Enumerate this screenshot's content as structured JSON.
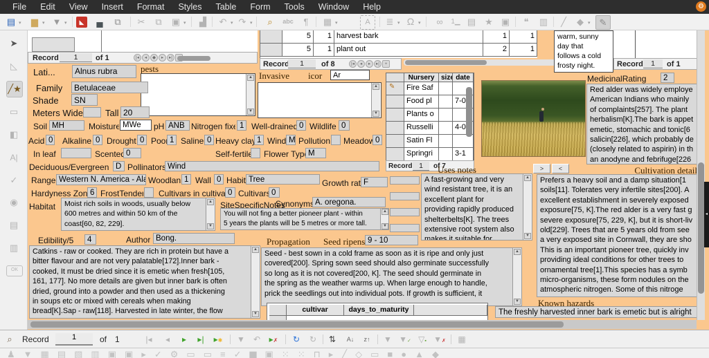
{
  "menubar": {
    "items": [
      "File",
      "Edit",
      "View",
      "Insert",
      "Format",
      "Styles",
      "Table",
      "Form",
      "Tools",
      "Window",
      "Help"
    ]
  },
  "navs": {
    "tl": {
      "label": "Record",
      "value": "1",
      "of": "of 1"
    },
    "task": {
      "label": "Record",
      "value": "1",
      "of": "of 8"
    },
    "tr": {
      "label": "Record",
      "value": "1",
      "of": "of 1"
    },
    "nursery": {
      "label": "Record",
      "value": "1",
      "of": "of 7"
    },
    "bottom": {
      "label": "Record",
      "value": "1",
      "of_label": "of",
      "count": "1"
    }
  },
  "task_table": {
    "rows": [
      [
        "5",
        "1",
        "harvest bark",
        "1",
        "1"
      ],
      [
        "5",
        "1",
        "plant out",
        "2",
        "1"
      ]
    ]
  },
  "note_text": "warm, sunny\nday that\nfollows a cold\nfrosty night.",
  "f": {
    "lati": {
      "l": "Lati...",
      "v": "Alnus rubra"
    },
    "family": {
      "l": "Family",
      "v": "Betulaceae"
    },
    "shade": {
      "l": "Shade",
      "v": "SN"
    },
    "meters_wide": {
      "l": "Meters Wide",
      "v": ""
    },
    "tall": {
      "l": "Tall",
      "v": "20"
    },
    "soil": {
      "l": "Soil",
      "v": "MH"
    },
    "moisture": {
      "l": "Moisture",
      "v": "MWe"
    },
    "ph": {
      "l": "pH",
      "v": "ANB"
    },
    "nitrogen": {
      "l": "Nitrogen fixer",
      "v": "1"
    },
    "well_drained": {
      "l": "Well-drained",
      "v": "0"
    },
    "wildlife": {
      "l": "Wildlife",
      "v": "0"
    },
    "acid": {
      "l": "Acid",
      "v": "0"
    },
    "alkaline": {
      "l": "Alkaline",
      "v": "0"
    },
    "drought": {
      "l": "Drought",
      "v": "0"
    },
    "poor": {
      "l": "Poor",
      "v": "1"
    },
    "saline": {
      "l": "Saline",
      "v": "0"
    },
    "heavy_clay": {
      "l": "Heavy clay",
      "v": "1"
    },
    "wind": {
      "l": "Wind",
      "v": "M"
    },
    "pollution": {
      "l": "Pollution",
      "v": ""
    },
    "meadow": {
      "l": "Meadow",
      "v": "0"
    },
    "in_leaf": {
      "l": "In leaf",
      "v": ""
    },
    "scented": {
      "l": "Scented",
      "v": "0"
    },
    "self_fertile": {
      "l": "Self-fertile",
      "v": ""
    },
    "flower_type": {
      "l": "Flower Type",
      "v": "M"
    },
    "deciduous": {
      "l": "Deciduous/Evergreen",
      "v": "D"
    },
    "pollinators": {
      "l": "Pollinators",
      "v": "Wind"
    },
    "range": {
      "l": "Range",
      "v": "Western N. America - Alas"
    },
    "woodland": {
      "l": "Woodland",
      "v": "1"
    },
    "wall": {
      "l": "Wall",
      "v": "0"
    },
    "habit": {
      "l": "Habit",
      "v": "Tree"
    },
    "growth_rate": {
      "l": "Growth rate",
      "v": "F"
    },
    "hardyness": {
      "l": "Hardyness Zone",
      "v": "6"
    },
    "frost_tender": {
      "l": "FrostTender",
      "v": ""
    },
    "cult_in_cult": {
      "l": "Cultivars in cultivation",
      "v": "0"
    },
    "cultivars": {
      "l": "Cultivars",
      "v": "0"
    },
    "habitat": {
      "l": "Habitat",
      "v": "Moist rich soils in woods, usually below\n600 metres and within 50 km of the\ncoast[60, 82, 229]."
    },
    "site_notes": {
      "l": "SiteSpecificNotes",
      "v": "You will not fing a better pioneer plant - within\n5 years the plants will be 5 metres or more tall."
    },
    "synonyms": {
      "l": "Synonyms",
      "v": "A. oregona."
    },
    "edibility": {
      "l": "Edibility/5",
      "v": "4"
    },
    "author": {
      "l": "Author",
      "v": "Bong."
    },
    "pests": {
      "l": "pests"
    },
    "invasive": {
      "l": "Invasive"
    },
    "icor": {
      "l": "icor",
      "v": "Ar"
    },
    "propagation": {
      "l": "Propagation"
    },
    "seed_ripens": {
      "l": "Seed ripens",
      "v": "9 - 10"
    },
    "medicinal": {
      "l": "MedicinalRating",
      "v": "2"
    }
  },
  "texts": {
    "edibility_text": "Catkins - raw or cooked. They are rich in protein but have a\nbitter flavour and are not very palatable[172].Inner bark -\ncooked, It must be dried since it is emetic when fresh[105,\n161, 177]. No more details are given but inner bark is often\ndried, ground into a powder and then used as a thickening\nin soups etc or mixed with cereals when making\nbread[K].Sap - raw[118]. Harvested in late winter, the flow\nis best on a warm sunny day that follows a cold frosty",
    "seed_text": "Seed - best sown in a cold frame as soon as it is ripe and only just\ncovered[200]. Spring sown seed should also germinate successfully\nso long as it is not covered[200, K]. The seed should germinate in\nthe spring as the weather warms up. When large enough to handle,\nprick the seedlings out into individual pots. If growth is sufficient, it",
    "uses_label": "Uses notes",
    "uses_next": ">",
    "uses_prev": "<",
    "uses_text": "A fast-growing and very\nwind resistant tree, it is an\nexcellent plant for\nproviding rapidly produced\nshelterbelts[K]. The trees\nextensive root system also\nmakes it suitable for",
    "medicinal_text": "Red alder was widely employe\nAmerican Indians who mainly\nof complaints[257]. The plant\nherbalism[K].The bark is appet\nemetic, stomachic and tonic[6\nsalicin[226], which probably de\n(closely related to aspirin) in th\nan anodyne and febrifuge[226",
    "cultivation_label": "Cultivation details",
    "cultivation_text": "Prefers a heavy soil and a damp situation[1\nsoils[11]. Tolerates very infertile sites[200]. A\nexcellent establishment in severely exposed\nexposure[75, K].The red alder is a very fast g\nsevere exposure[75, 229, K], but it is short-liv\nold[229]. Trees that are 5 years old from see\na very exposed site in Cornwall, they are sho\nThis is an important pioneer tree, quickly inv\nproviding ideal conditions for other trees to\nornamental tree[1].This species has a symb\nmicro-organisms, these form nodules on the\natmospheric nitrogen. Some of this nitroge",
    "hazards_label": "Known hazards",
    "hazards_text": "The freshly harvested inner bark is emetic but is alright"
  },
  "nursery": {
    "headers": [
      "Nursery",
      "size",
      "date"
    ],
    "rows": [
      [
        "Fire Saf",
        "",
        ""
      ],
      [
        "Food pl",
        "",
        "7-0"
      ],
      [
        "Plants o",
        "",
        ""
      ],
      [
        "Russelli",
        "",
        "4-0"
      ],
      [
        "Satin Fl",
        "",
        ""
      ],
      [
        "Springri",
        "",
        "3-1"
      ]
    ]
  },
  "cultivar_table": {
    "h1": "cultivar",
    "h2": "days_to_maturity"
  },
  "colors": {
    "form_bg": "#fbc78e",
    "accent_green": "#3fa32a",
    "refresh_blue": "#2a72d8",
    "pdf_red": "#c8342a"
  }
}
